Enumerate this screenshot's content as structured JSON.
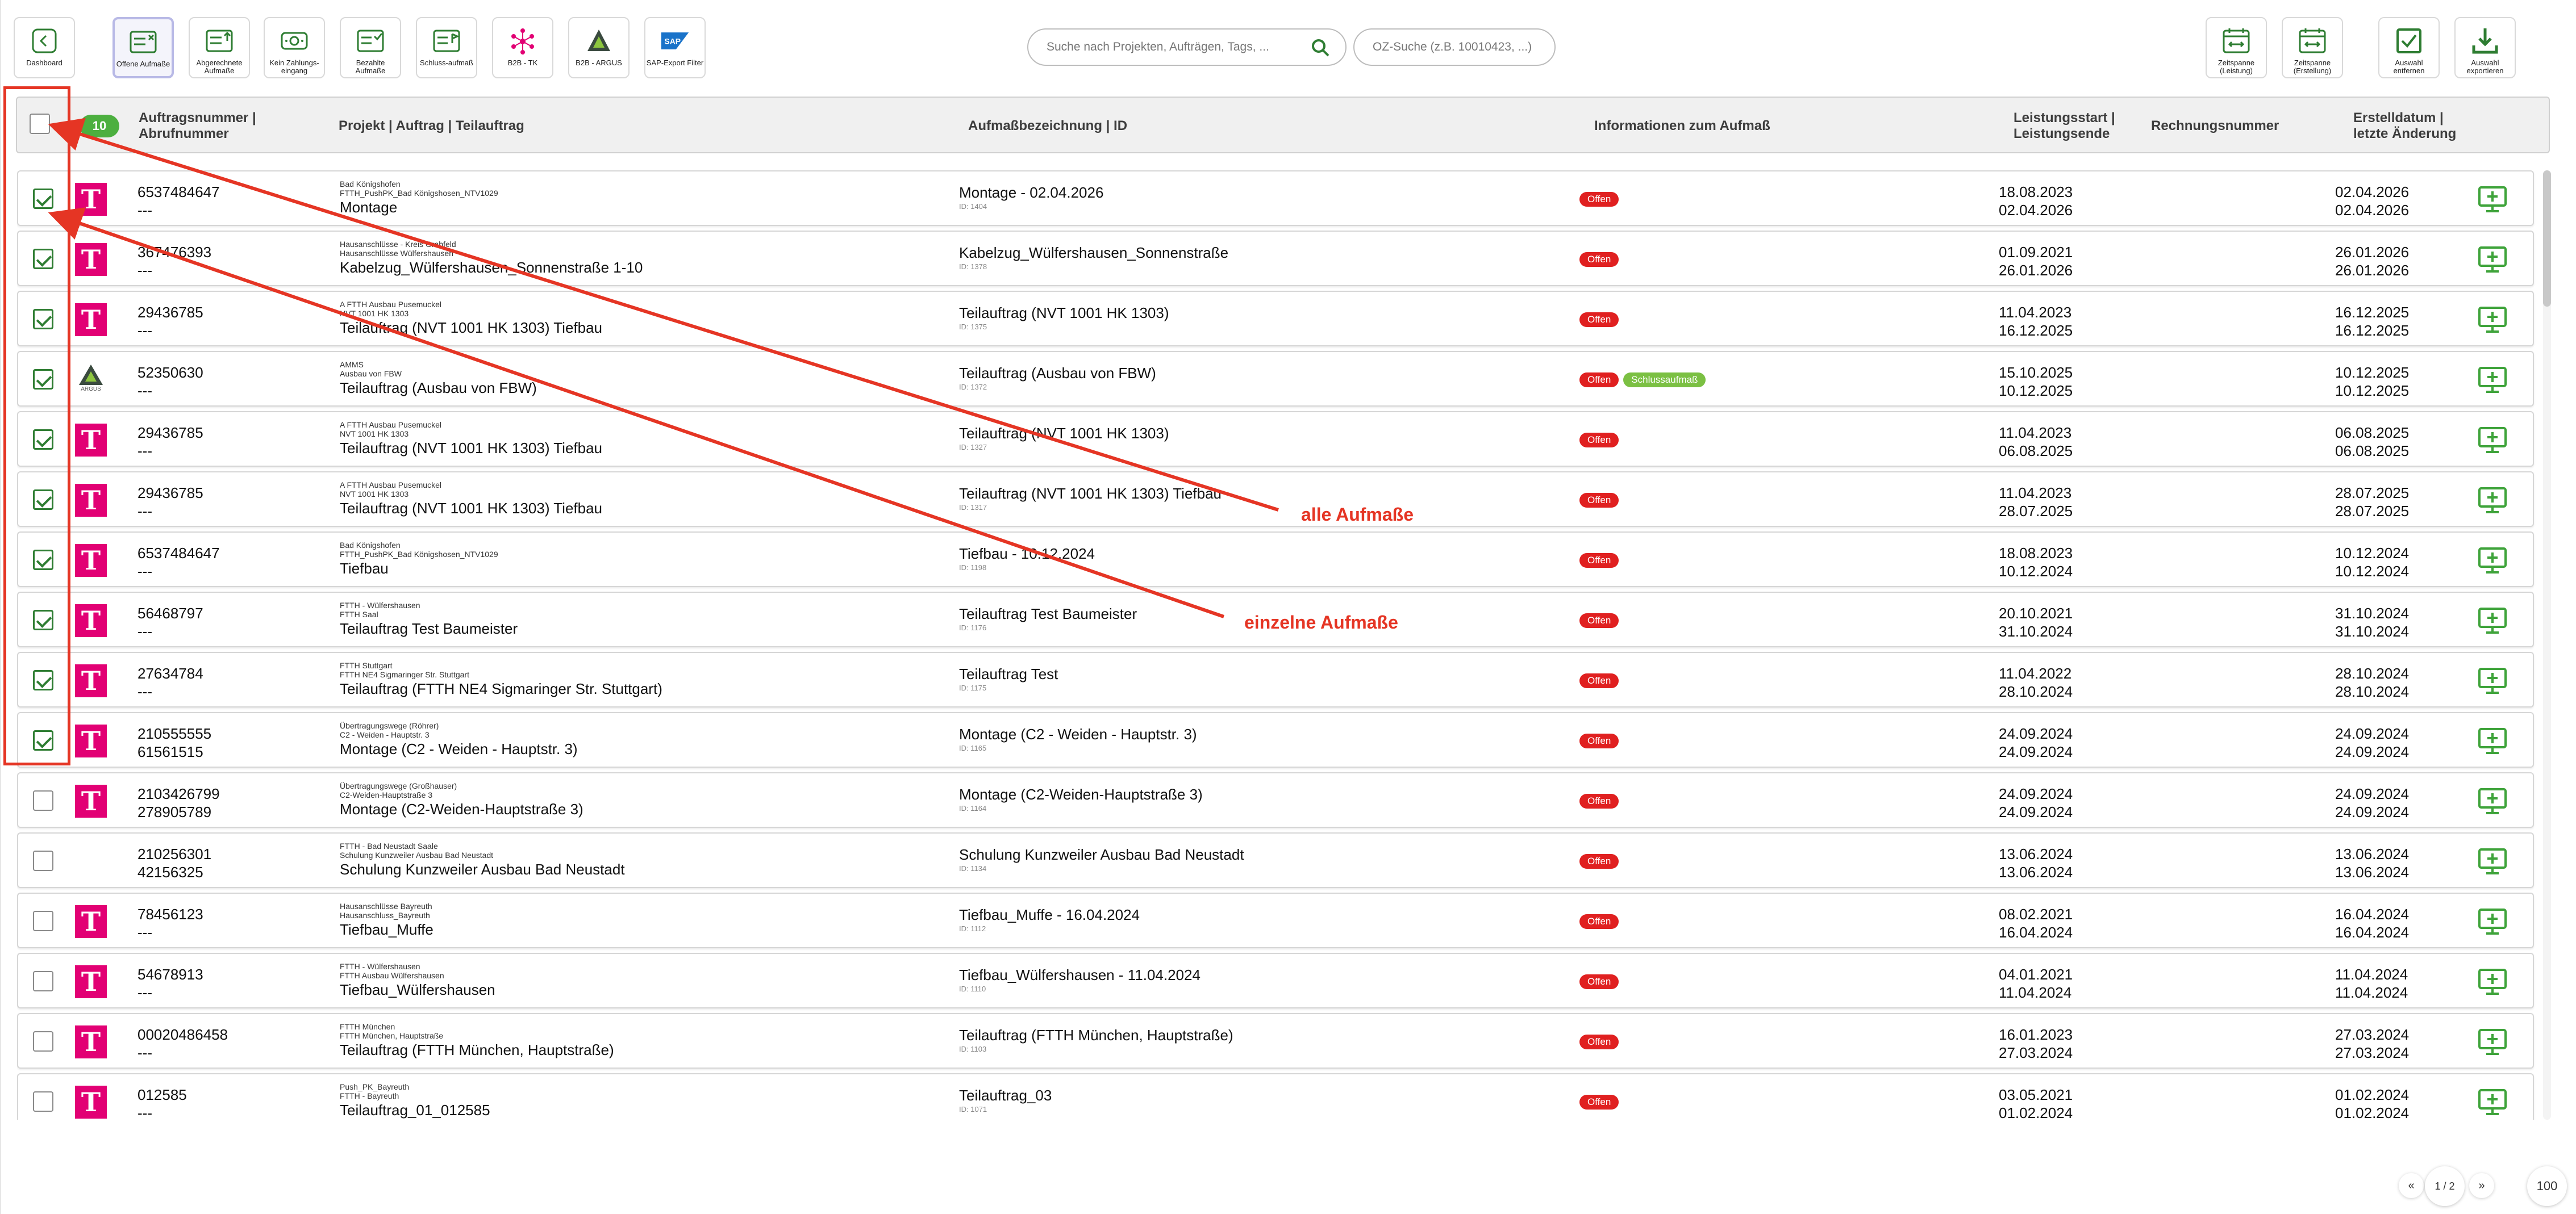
{
  "toolbar": {
    "dashboard": "Dashboard",
    "offene": "Offene Aufmaße",
    "abgerechnete": "Abgerechnete Aufmaße",
    "kein_zahlung": "Kein Zahlungs-eingang",
    "bezahlte": "Bezahlte Aufmaße",
    "schluss": "Schluss-aufmaß",
    "b2b_tk": "B2B - TK",
    "b2b_argus": "B2B - ARGUS",
    "sap": "SAP-Export Filter",
    "sap_logo": "SAP",
    "zeitspanne_leistung": "Zeitspanne (Leistung)",
    "zeitspanne_erstellung": "Zeitspanne (Erstellung)",
    "auswahl_entfernen": "Auswahl entfernen",
    "auswahl_exportieren": "Auswahl exportieren"
  },
  "search": {
    "main_placeholder": "Suche nach Projekten, Aufträgen, Tags, ...",
    "oz_placeholder": "OZ-Suche (z.B. 10010423, ...)"
  },
  "header": {
    "count": "10",
    "col_auftrag": "Auftragsnummer | Abrufnummer",
    "col_projekt": "Projekt | Auftrag | Teilauftrag",
    "col_aufmass": "Aufmaßbezeichnung | ID",
    "col_info": "Informationen zum Aufmaß",
    "col_leistung": "Leistungsstart | Leistungsende",
    "col_rechnung": "Rechnungsnummer",
    "col_erstell": "Erstelldatum | letzte Änderung"
  },
  "annotations": {
    "alle": "alle Aufmaße",
    "einzelne": "einzelne Aufmaße"
  },
  "rows": [
    {
      "checked": true,
      "logo": "telekom",
      "logo_text": "T",
      "n1": "6537484647",
      "n2": "---",
      "s1": "Bad Königshofen",
      "s2": "FTTH_PushPK_Bad Königshosen_NTV1029",
      "main": "Montage",
      "auf": "Montage - 02.04.2026",
      "id": "ID: 1404",
      "tags": [
        "Offen"
      ],
      "ls": "18.08.2023",
      "le": "02.04.2026",
      "e1": "02.04.2026",
      "e2": "02.04.2026"
    },
    {
      "checked": true,
      "logo": "telekom",
      "logo_text": "T",
      "n1": "367476393",
      "n2": "---",
      "s1": "Hausanschlüsse - Kreis Grabfeld",
      "s2": "Hausanschlüsse Wülfershausen",
      "main": "Kabelzug_Wülfershausen_Sonnenstraße 1-10",
      "auf": "Kabelzug_Wülfershausen_Sonnenstraße",
      "id": "ID: 1378",
      "tags": [
        "Offen"
      ],
      "ls": "01.09.2021",
      "le": "26.01.2026",
      "e1": "26.01.2026",
      "e2": "26.01.2026"
    },
    {
      "checked": true,
      "logo": "telekom",
      "logo_text": "T",
      "n1": "29436785",
      "n2": "---",
      "s1": "A FTTH Ausbau Pusemuckel",
      "s2": "NVT 1001 HK 1303",
      "main": "Teilauftrag (NVT 1001 HK 1303) Tiefbau",
      "auf": "Teilauftrag (NVT 1001 HK 1303)",
      "id": "ID: 1375",
      "tags": [
        "Offen"
      ],
      "ls": "11.04.2023",
      "le": "16.12.2025",
      "e1": "16.12.2025",
      "e2": "16.12.2025"
    },
    {
      "checked": true,
      "logo": "argus",
      "logo_text": "ARGUS",
      "n1": "52350630",
      "n2": "---",
      "s1": "AMMS",
      "s2": "Ausbau von FBW",
      "main": "Teilauftrag (Ausbau von FBW)",
      "auf": "Teilauftrag (Ausbau von FBW)",
      "id": "ID: 1372",
      "tags": [
        "Offen",
        "Schlussaufmaß"
      ],
      "ls": "15.10.2025",
      "le": "10.12.2025",
      "e1": "10.12.2025",
      "e2": "10.12.2025"
    },
    {
      "checked": true,
      "logo": "telekom",
      "logo_text": "T",
      "n1": "29436785",
      "n2": "---",
      "s1": "A FTTH Ausbau Pusemuckel",
      "s2": "NVT 1001 HK 1303",
      "main": "Teilauftrag (NVT 1001 HK 1303) Tiefbau",
      "auf": "Teilauftrag (NVT 1001 HK 1303)",
      "id": "ID: 1327",
      "tags": [
        "Offen"
      ],
      "ls": "11.04.2023",
      "le": "06.08.2025",
      "e1": "06.08.2025",
      "e2": "06.08.2025"
    },
    {
      "checked": true,
      "logo": "telekom",
      "logo_text": "T",
      "n1": "29436785",
      "n2": "---",
      "s1": "A FTTH Ausbau Pusemuckel",
      "s2": "NVT 1001 HK 1303",
      "main": "Teilauftrag (NVT 1001 HK 1303) Tiefbau",
      "auf": "Teilauftrag (NVT 1001 HK 1303) Tiefbau",
      "id": "ID: 1317",
      "tags": [
        "Offen"
      ],
      "ls": "11.04.2023",
      "le": "28.07.2025",
      "e1": "28.07.2025",
      "e2": "28.07.2025"
    },
    {
      "checked": true,
      "logo": "telekom",
      "logo_text": "T",
      "n1": "6537484647",
      "n2": "---",
      "s1": "Bad Königshofen",
      "s2": "FTTH_PushPK_Bad Königshosen_NTV1029",
      "main": "Tiefbau",
      "auf": "Tiefbau - 10.12.2024",
      "id": "ID: 1198",
      "tags": [
        "Offen"
      ],
      "ls": "18.08.2023",
      "le": "10.12.2024",
      "e1": "10.12.2024",
      "e2": "10.12.2024"
    },
    {
      "checked": true,
      "logo": "telekom",
      "logo_text": "T",
      "n1": "56468797",
      "n2": "---",
      "s1": "FTTH - Wülfershausen",
      "s2": "FTTH Saal",
      "main": "Teilauftrag Test Baumeister",
      "auf": "Teilauftrag Test Baumeister",
      "id": "ID: 1176",
      "tags": [
        "Offen"
      ],
      "ls": "20.10.2021",
      "le": "31.10.2024",
      "e1": "31.10.2024",
      "e2": "31.10.2024"
    },
    {
      "checked": true,
      "logo": "telekom",
      "logo_text": "T",
      "n1": "27634784",
      "n2": "---",
      "s1": "FTTH Stuttgart",
      "s2": "FTTH NE4 Sigmaringer Str. Stuttgart",
      "main": "Teilauftrag (FTTH NE4 Sigmaringer Str. Stuttgart)",
      "auf": "Teilauftrag Test",
      "id": "ID: 1175",
      "tags": [
        "Offen"
      ],
      "ls": "11.04.2022",
      "le": "28.10.2024",
      "e1": "28.10.2024",
      "e2": "28.10.2024"
    },
    {
      "checked": true,
      "logo": "telekom",
      "logo_text": "T",
      "n1": "210555555",
      "n2": "61561515",
      "s1": "Übertragungswege (Röhrer)",
      "s2": "C2 - Weiden - Hauptstr. 3",
      "main": "Montage (C2 - Weiden - Hauptstr. 3)",
      "auf": "Montage (C2 - Weiden - Hauptstr. 3)",
      "id": "ID: 1165",
      "tags": [
        "Offen"
      ],
      "ls": "24.09.2024",
      "le": "24.09.2024",
      "e1": "24.09.2024",
      "e2": "24.09.2024"
    },
    {
      "checked": false,
      "logo": "telekom",
      "logo_text": "T",
      "n1": "2103426799",
      "n2": "278905789",
      "s1": "Übertragungswege (Großhauser)",
      "s2": "C2-Weiden-Hauptstraße 3",
      "main": "Montage (C2-Weiden-Hauptstraße 3)",
      "auf": "Montage (C2-Weiden-Hauptstraße 3)",
      "id": "ID: 1164",
      "tags": [
        "Offen"
      ],
      "ls": "24.09.2024",
      "le": "24.09.2024",
      "e1": "24.09.2024",
      "e2": "24.09.2024"
    },
    {
      "checked": false,
      "logo": "none",
      "logo_text": "",
      "n1": "210256301",
      "n2": "42156325",
      "s1": "FTTH - Bad Neustadt Saale",
      "s2": "Schulung Kunzweiler Ausbau Bad Neustadt",
      "main": "Schulung Kunzweiler Ausbau Bad Neustadt",
      "auf": "Schulung Kunzweiler Ausbau Bad Neustadt",
      "id": "ID: 1134",
      "tags": [
        "Offen"
      ],
      "ls": "13.06.2024",
      "le": "13.06.2024",
      "e1": "13.06.2024",
      "e2": "13.06.2024"
    },
    {
      "checked": false,
      "logo": "telekom",
      "logo_text": "T",
      "n1": "78456123",
      "n2": "---",
      "s1": "Hausanschlüsse Bayreuth",
      "s2": "Hausanschluss_Bayreuth",
      "main": "Tiefbau_Muffe",
      "auf": "Tiefbau_Muffe - 16.04.2024",
      "id": "ID: 1112",
      "tags": [
        "Offen"
      ],
      "ls": "08.02.2021",
      "le": "16.04.2024",
      "e1": "16.04.2024",
      "e2": "16.04.2024"
    },
    {
      "checked": false,
      "logo": "telekom",
      "logo_text": "T",
      "n1": "54678913",
      "n2": "---",
      "s1": "FTTH - Wülfershausen",
      "s2": "FTTH Ausbau Wülfershausen",
      "main": "Tiefbau_Wülfershausen",
      "auf": "Tiefbau_Wülfershausen - 11.04.2024",
      "id": "ID: 1110",
      "tags": [
        "Offen"
      ],
      "ls": "04.01.2021",
      "le": "11.04.2024",
      "e1": "11.04.2024",
      "e2": "11.04.2024"
    },
    {
      "checked": false,
      "logo": "telekom",
      "logo_text": "T",
      "n1": "00020486458",
      "n2": "---",
      "s1": "FTTH München",
      "s2": "FTTH München, Hauptstraße",
      "main": "Teilauftrag (FTTH München, Hauptstraße)",
      "auf": "Teilauftrag (FTTH München, Hauptstraße)",
      "id": "ID: 1103",
      "tags": [
        "Offen"
      ],
      "ls": "16.01.2023",
      "le": "27.03.2024",
      "e1": "27.03.2024",
      "e2": "27.03.2024"
    },
    {
      "checked": false,
      "logo": "telekom",
      "logo_text": "T",
      "n1": "012585",
      "n2": "---",
      "s1": "Push_PK_Bayreuth",
      "s2": "FTTH - Bayreuth",
      "main": "Teilauftrag_01_012585",
      "auf": "Teilauftrag_03",
      "id": "ID: 1071",
      "tags": [
        "Offen"
      ],
      "ls": "03.05.2021",
      "le": "01.02.2024",
      "e1": "01.02.2024",
      "e2": "01.02.2024"
    }
  ],
  "pager": {
    "prev": "«",
    "page": "1 / 2",
    "next": "»",
    "per_page": "100"
  },
  "colors": {
    "telekom": "#e20074",
    "green": "#4caf3f",
    "offen": "#e02020",
    "schluss": "#7bc043",
    "annotation": "#e53524"
  }
}
